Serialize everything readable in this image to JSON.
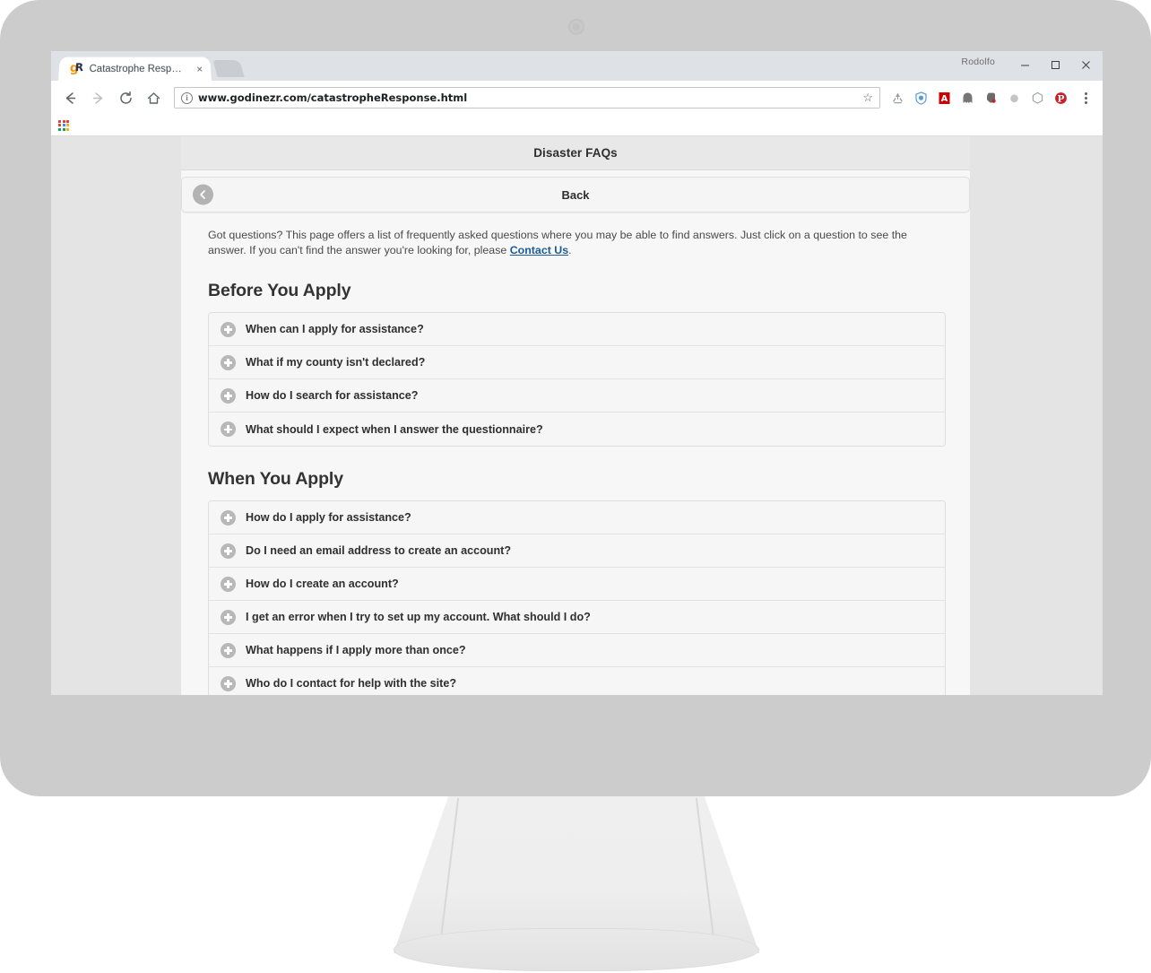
{
  "browser": {
    "tab": {
      "title": "Catastrophe Response",
      "favicon_letters": [
        "g",
        "R"
      ],
      "close_label": "×"
    },
    "profile_name": "Rodolfo",
    "window_controls": {
      "minimize": "minimize-icon",
      "maximize": "maximize-icon",
      "close": "close-icon"
    },
    "toolbar": {
      "back_icon": "back-arrow-icon",
      "forward_icon": "forward-arrow-icon",
      "reload_icon": "reload-icon",
      "home_icon": "home-icon",
      "info_badge": "i",
      "url": "www.godinezr.com/catastropheResponse.html",
      "bookmark_star": "☆",
      "extensions": [
        "recycle-icon",
        "shield-icon",
        "adobe-acrobat-icon",
        "ghostery-icon",
        "evernote-icon",
        "gray-dot-icon",
        "cube-icon",
        "pinterest-icon"
      ],
      "menu": "three-dot-menu-icon"
    },
    "bookmarks_bar": {
      "apps_icon": "apps-grid-icon",
      "overflow": "»"
    }
  },
  "page": {
    "header_title": "Disaster FAQs",
    "back_bar": {
      "label": "Back",
      "icon": "back-chevron-icon"
    },
    "intro": {
      "before_link": "Got questions? This page offers a list of frequently asked questions where you may be able to find answers. Just click on a question to see the answer. If you can't find the answer you're looking for, please ",
      "link_text": "Contact Us",
      "after_link": "."
    },
    "sections": [
      {
        "heading": "Before You Apply",
        "items": [
          "When can I apply for assistance?",
          "What if my county isn't declared?",
          "How do I search for assistance?",
          "What should I expect when I answer the questionnaire?"
        ]
      },
      {
        "heading": "When You Apply",
        "items": [
          "How do I apply for assistance?",
          "Do I need an email address to create an account?",
          "How do I create an account?",
          "I get an error when I try to set up my account. What should I do?",
          "What happens if I apply more than once?",
          "Who do I contact for help with the site?",
          ""
        ]
      }
    ]
  }
}
